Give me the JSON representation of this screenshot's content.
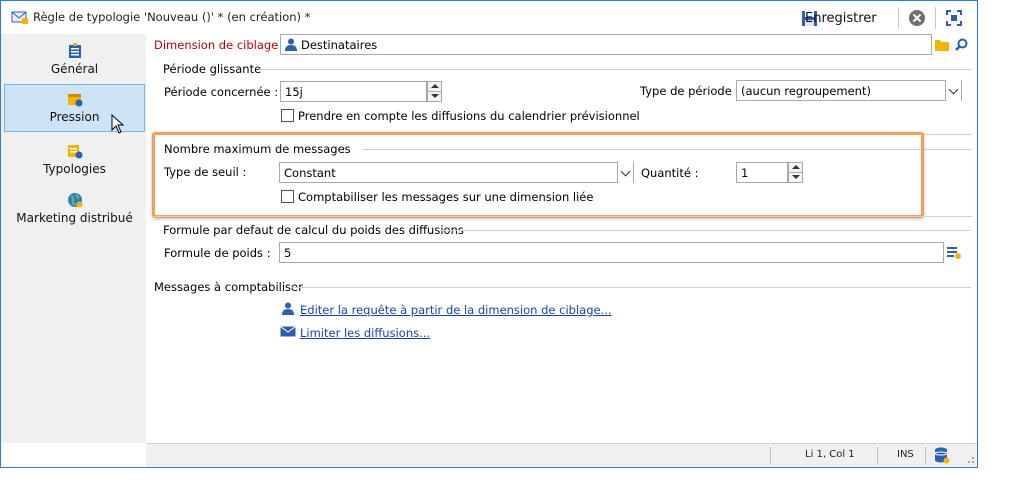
{
  "window": {
    "title": "Règle de typologie 'Nouveau ()' * (en création) *"
  },
  "toolbar": {
    "save_label": "Enregistrer"
  },
  "sidebar": {
    "items": [
      {
        "label": "Général",
        "icon": "general-icon",
        "selected": false
      },
      {
        "label": "Pression",
        "icon": "pression-icon",
        "selected": true
      },
      {
        "label": "Typologies",
        "icon": "typologies-icon",
        "selected": false
      },
      {
        "label": "Marketing distribué",
        "icon": "globe-icon",
        "selected": false
      }
    ]
  },
  "targeting": {
    "label": "Dimension de ciblage :",
    "value": "Destinataires"
  },
  "period": {
    "group_title": "Période glissante",
    "concerned_label": "Période concernée :",
    "concerned_value": "15j",
    "type_label": "Type de période :",
    "type_value": "(aucun regroupement)",
    "calendar_checkbox_label": "Prendre en compte les diffusions du calendrier prévisionnel",
    "calendar_checked": false
  },
  "max_messages": {
    "group_title": "Nombre maximum de messages",
    "threshold_label": "Type de seuil :",
    "threshold_value": "Constant",
    "quantity_label": "Quantité :",
    "quantity_value": "1",
    "linked_checkbox_label": "Comptabiliser les messages sur une dimension liée",
    "linked_checked": false
  },
  "weight": {
    "group_title": "Formule par defaut de calcul du poids des diffusions",
    "formula_label": "Formule de poids :",
    "formula_value": "5"
  },
  "messages": {
    "group_title": "Messages à comptabiliser",
    "edit_query_link": "Editer la requête à partir de la dimension de ciblage...",
    "limit_link": "Limiter les diffusions..."
  },
  "status": {
    "position": "Li 1, Col 1",
    "mode": "INS"
  },
  "colors": {
    "highlight": "#f0a058",
    "required_label": "#c00000",
    "link": "#1a3fb0",
    "selection": "#cce4f7"
  }
}
